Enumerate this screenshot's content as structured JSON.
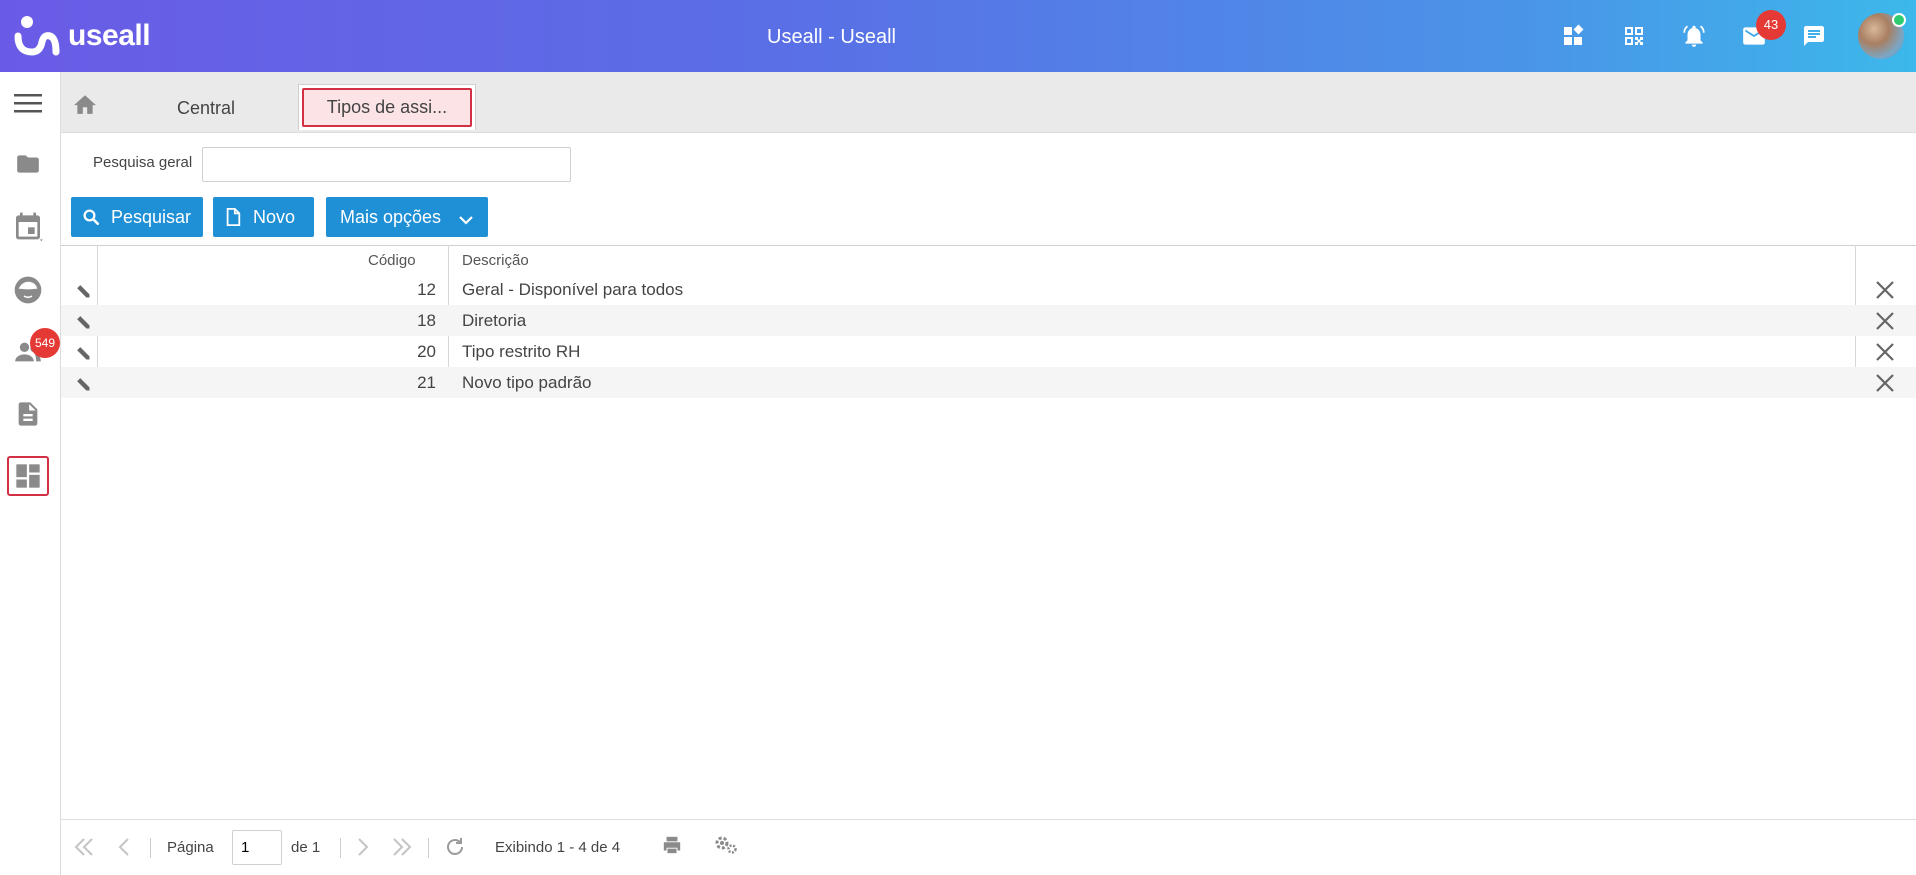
{
  "header": {
    "brand": "useall",
    "title": "Useall - Useall",
    "mail_badge": "43",
    "icons": [
      "widgets-icon",
      "qr-code-icon",
      "bell-icon",
      "mail-icon",
      "chat-icon"
    ]
  },
  "sidebar": {
    "users_badge": "549",
    "items": [
      "menu-icon",
      "folder-icon",
      "calendar-icon",
      "face-icon",
      "people-icon",
      "document-icon",
      "dashboard-icon"
    ]
  },
  "tabs": {
    "central": "Central",
    "active": "Tipos de assi..."
  },
  "search": {
    "label": "Pesquisa geral",
    "value": ""
  },
  "toolbar": {
    "search_label": "Pesquisar",
    "new_label": "Novo",
    "more_label": "Mais opções"
  },
  "grid": {
    "columns": {
      "code": "Código",
      "description": "Descrição"
    },
    "rows": [
      {
        "code": "12",
        "description": "Geral - Disponível para todos"
      },
      {
        "code": "18",
        "description": "Diretoria"
      },
      {
        "code": "20",
        "description": "Tipo restrito RH"
      },
      {
        "code": "21",
        "description": "Novo tipo padrão"
      }
    ]
  },
  "pager": {
    "page_label": "Página",
    "page_value": "1",
    "of_label": "de 1",
    "showing": "Exibindo 1 - 4 de 4"
  },
  "colors": {
    "accent": "#1f8fd6",
    "active_tab_border": "#d32f45",
    "badge": "#e53935"
  }
}
